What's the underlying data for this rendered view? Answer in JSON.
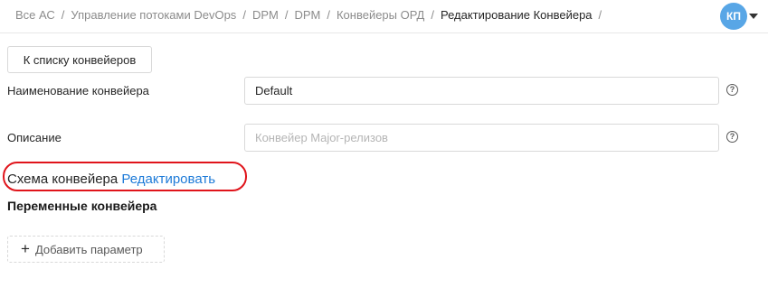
{
  "breadcrumb": {
    "items": [
      "Все АС",
      "Управление потоками DevOps",
      "DPM",
      "DPM",
      "Конвейеры ОРД"
    ],
    "current": "Редактирование Конвейера",
    "separator": "/"
  },
  "user": {
    "initials": "КП",
    "avatar_color": "#58a6e6"
  },
  "back_button": {
    "label": "К списку конвейеров"
  },
  "form": {
    "name": {
      "label": "Наименование конвейера",
      "value": "Default",
      "help_icon": "question-circle-icon"
    },
    "description": {
      "label": "Описание",
      "value": "",
      "placeholder": "Конвейер Major-релизов",
      "help_icon": "question-circle-icon"
    }
  },
  "schema": {
    "label": "Схема конвейера",
    "edit_link": "Редактировать",
    "highlight_color": "#e0141b"
  },
  "variables": {
    "title": "Переменные конвейера",
    "add_button": "Добавить параметр",
    "add_icon": "plus-icon"
  },
  "colors": {
    "link": "#1e7bd8",
    "border": "#d9d9d9"
  }
}
